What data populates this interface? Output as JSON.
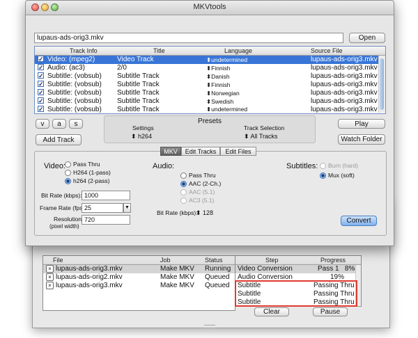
{
  "window": {
    "title": "MKVtools"
  },
  "file_field": {
    "value": "lupaus-ads-orig3.mkv"
  },
  "open_button": "Open",
  "track_table": {
    "headers": [
      "Track Info",
      "Title",
      "Language",
      "Source File"
    ],
    "rows": [
      {
        "info": "Video: (mpeg2)",
        "title": "Video Track",
        "language": "undetermined",
        "source": "lupaus-ads-orig3.mkv",
        "checked": true,
        "selected": true
      },
      {
        "info": "Audio: (ac3)",
        "title": "2/0",
        "language": "Finnish",
        "source": "lupaus-ads-orig3.mkv",
        "checked": true
      },
      {
        "info": "Subtitle: (vobsub)",
        "title": "Subtitle Track",
        "language": "Danish",
        "source": "lupaus-ads-orig3.mkv",
        "checked": true
      },
      {
        "info": "Subtitle: (vobsub)",
        "title": "Subtitle Track",
        "language": "Finnish",
        "source": "lupaus-ads-orig3.mkv",
        "checked": true
      },
      {
        "info": "Subtitle: (vobsub)",
        "title": "Subtitle Track",
        "language": "Norwegian",
        "source": "lupaus-ads-orig3.mkv",
        "checked": true
      },
      {
        "info": "Subtitle: (vobsub)",
        "title": "Subtitle Track",
        "language": "Swedish",
        "source": "lupaus-ads-orig3.mkv",
        "checked": true
      },
      {
        "info": "Subtitle: (vobsub)",
        "title": "Subtitle Track",
        "language": "undetermined",
        "source": "lupaus-ads-orig3.mkv",
        "checked": true
      }
    ]
  },
  "small_buttons": {
    "v": "v",
    "a": "a",
    "s": "s"
  },
  "add_track_button": "Add Track",
  "presets": {
    "title": "Presets",
    "settings_label": "Settings",
    "settings_value": "h264",
    "track_selection_label": "Track Selection",
    "track_selection_value": "All Tracks"
  },
  "play_button": "Play",
  "watch_folder_button": "Watch Folder",
  "tabs": [
    "MKV",
    "Edit Tracks",
    "Edit Files"
  ],
  "video": {
    "label": "Video:",
    "options": [
      "Pass Thru",
      "H264 (1-pass)",
      "h264 (2-pass)"
    ],
    "selected": 2
  },
  "audio": {
    "label": "Audio:",
    "options": [
      "Pass Thru",
      "AAC (2-Ch.)",
      "AAC (5.1)",
      "AC3 (5.1)"
    ],
    "selected": 1
  },
  "subtitles": {
    "label": "Subtitles:",
    "options": [
      "Burn (hard)",
      "Mux (soft)"
    ],
    "selected": 1
  },
  "bit_rate": {
    "label": "Bit Rate (kbps):",
    "value": "1000"
  },
  "frame_rate": {
    "label": "Frame Rate (fps):",
    "value": "25"
  },
  "resolution": {
    "label": "Resolution",
    "sublabel": "(pixel width)",
    "value": "720"
  },
  "audio_bit_rate": {
    "label": "Bit Rate (kbps):",
    "value": "128"
  },
  "convert_button": "Convert",
  "queue": {
    "headers": [
      "File",
      "Job",
      "Status"
    ],
    "rows": [
      {
        "file": "lupaus-ads-orig3.mkv",
        "job": "Make MKV",
        "status": "Running",
        "selected": true
      },
      {
        "file": "lupaus-ads-orig2.mkv",
        "job": "Make MKV",
        "status": "Queued"
      },
      {
        "file": "lupaus-ads-orig3.mkv",
        "job": "Make MKV",
        "status": "Queued"
      }
    ]
  },
  "steps": {
    "headers": [
      "Step",
      "Progress"
    ],
    "rows": [
      {
        "step": "Video Conversion",
        "progress": "Pass 1   8%",
        "selected": true
      },
      {
        "step": "Audio Conversion",
        "progress": "19%"
      },
      {
        "step": "Subtitle",
        "progress": "Passing Thru"
      },
      {
        "step": "Subtitle",
        "progress": "Passing Thru"
      },
      {
        "step": "Subtitle",
        "progress": "Passing Thru"
      }
    ]
  },
  "clear_button": "Clear",
  "pause_button": "Pause",
  "colors": {
    "selection": "#3875d7",
    "highlight_box": "#e03a2f",
    "convert_button": "#8fb9ee"
  }
}
